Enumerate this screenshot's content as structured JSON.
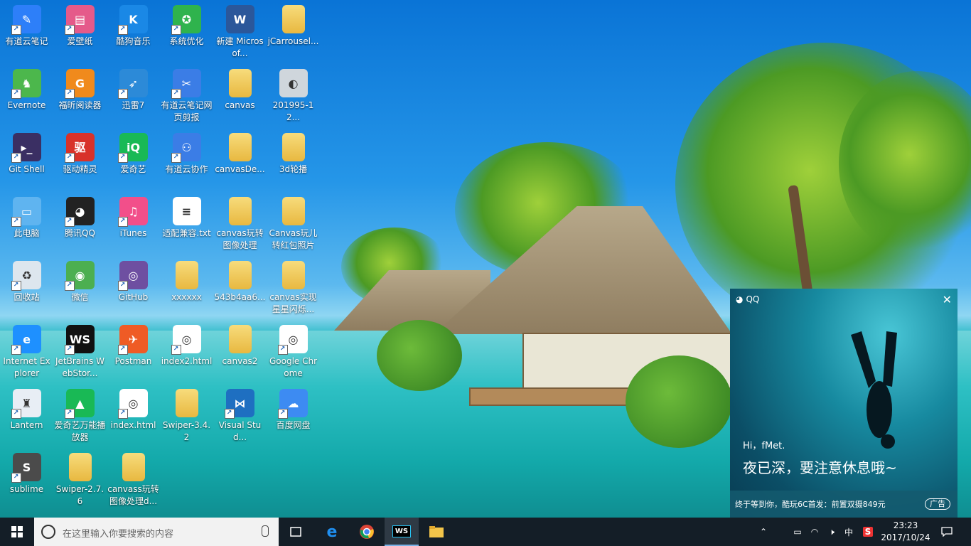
{
  "desktop": {
    "icons": [
      {
        "label": "有道云笔记",
        "icon": "youdao-note-icon",
        "color": "#2d7ff9",
        "glyph": "✎"
      },
      {
        "label": "爱壁纸",
        "icon": "wallpaper-icon",
        "color": "#e55a8a",
        "glyph": "▤"
      },
      {
        "label": "酷狗音乐",
        "icon": "kugou-icon",
        "color": "#1a88e6",
        "glyph": "K"
      },
      {
        "label": "系统优化",
        "icon": "system-optimize-icon",
        "color": "#2fb34d",
        "glyph": "✪"
      },
      {
        "label": "新建 Microsof...",
        "icon": "word-doc-icon",
        "color": "#2b579a",
        "glyph": "W"
      },
      {
        "label": "jCarrousel...",
        "icon": "folder-icon",
        "color": "#f0c850",
        "glyph": ""
      },
      {
        "label": "Evernote",
        "icon": "evernote-icon",
        "color": "#4cb74c",
        "glyph": "♞"
      },
      {
        "label": "福昕阅读器",
        "icon": "foxit-reader-icon",
        "color": "#f08a1c",
        "glyph": "G"
      },
      {
        "label": "迅雷7",
        "icon": "xunlei-icon",
        "color": "#2c8ad8",
        "glyph": "➶"
      },
      {
        "label": "有道云笔记网页剪报",
        "icon": "web-clipper-icon",
        "color": "#3b7de6",
        "glyph": "✂"
      },
      {
        "label": "canvas",
        "icon": "folder-icon",
        "color": "#f0c850",
        "glyph": ""
      },
      {
        "label": "201995-12...",
        "icon": "image-file-icon",
        "color": "#cfd6dc",
        "glyph": "◐"
      },
      {
        "label": "Git Shell",
        "icon": "git-shell-icon",
        "color": "#3a2f63",
        "glyph": "▸_"
      },
      {
        "label": "驱动精灵",
        "icon": "driver-genius-icon",
        "color": "#d8322a",
        "glyph": "驱"
      },
      {
        "label": "爱奇艺",
        "icon": "iqiyi-icon",
        "color": "#19b955",
        "glyph": "iQ"
      },
      {
        "label": "有道云协作",
        "icon": "youdao-collab-icon",
        "color": "#3b7de6",
        "glyph": "⚇"
      },
      {
        "label": "canvasDe...",
        "icon": "folder-icon",
        "color": "#f0c850",
        "glyph": ""
      },
      {
        "label": "3d轮播",
        "icon": "folder-icon",
        "color": "#f0c850",
        "glyph": ""
      },
      {
        "label": "此电脑",
        "icon": "this-pc-icon",
        "color": "#5fb4f0",
        "glyph": "▭"
      },
      {
        "label": "腾讯QQ",
        "icon": "qq-penguin-icon",
        "color": "#222222",
        "glyph": "◕"
      },
      {
        "label": "iTunes",
        "icon": "itunes-icon",
        "color": "#f24f8a",
        "glyph": "♫"
      },
      {
        "label": "适配兼容.txt",
        "icon": "text-file-icon",
        "color": "#ffffff",
        "glyph": "≡"
      },
      {
        "label": "canvas玩转图像处理",
        "icon": "folder-icon",
        "color": "#f0c850",
        "glyph": ""
      },
      {
        "label": "Canvas玩儿转红包照片",
        "icon": "folder-icon",
        "color": "#f0c850",
        "glyph": ""
      },
      {
        "label": "回收站",
        "icon": "recycle-bin-icon",
        "color": "#dde6ee",
        "glyph": "♻"
      },
      {
        "label": "微信",
        "icon": "wechat-icon",
        "color": "#4caf50",
        "glyph": "◉"
      },
      {
        "label": "GitHub",
        "icon": "github-icon",
        "color": "#6e4fa1",
        "glyph": "◎"
      },
      {
        "label": "xxxxxx",
        "icon": "folder-icon",
        "color": "#f0c850",
        "glyph": ""
      },
      {
        "label": "543b4aa6...",
        "icon": "folder-icon",
        "color": "#f0c850",
        "glyph": ""
      },
      {
        "label": "canvas实现星星闪烁...",
        "icon": "folder-icon",
        "color": "#f0c850",
        "glyph": ""
      },
      {
        "label": "Internet Explorer",
        "icon": "ie-icon",
        "color": "#1e90ff",
        "glyph": "e"
      },
      {
        "label": "JetBrains WebStor...",
        "icon": "webstorm-icon",
        "color": "#111111",
        "glyph": "WS"
      },
      {
        "label": "Postman",
        "icon": "postman-icon",
        "color": "#ef5b25",
        "glyph": "✈"
      },
      {
        "label": "index2.html",
        "icon": "chrome-html-icon",
        "color": "#ffffff",
        "glyph": "◎"
      },
      {
        "label": "canvas2",
        "icon": "folder-icon",
        "color": "#f0c850",
        "glyph": ""
      },
      {
        "label": "Google Chrome",
        "icon": "chrome-icon",
        "color": "#ffffff",
        "glyph": "◎"
      },
      {
        "label": "Lantern",
        "icon": "lantern-icon",
        "color": "#e8eef5",
        "glyph": "♜"
      },
      {
        "label": "爱奇艺万能播放器",
        "icon": "iqiyi-player-icon",
        "color": "#19b955",
        "glyph": "▲"
      },
      {
        "label": "index.html",
        "icon": "chrome-html-icon",
        "color": "#ffffff",
        "glyph": "◎"
      },
      {
        "label": "Swiper-3.4.2",
        "icon": "folder-icon",
        "color": "#f0c850",
        "glyph": ""
      },
      {
        "label": "Visual Stud...",
        "icon": "vscode-icon",
        "color": "#1e6fc1",
        "glyph": "⋈"
      },
      {
        "label": "百度网盘",
        "icon": "baidu-netdisk-icon",
        "color": "#3d8bf2",
        "glyph": "☁"
      },
      {
        "label": "sublime",
        "icon": "sublime-icon",
        "color": "#4b4b4b",
        "glyph": "S"
      },
      {
        "label": "Swiper-2.7.6",
        "icon": "folder-icon",
        "color": "#f0c850",
        "glyph": ""
      },
      {
        "label": "canvass玩转图像处理d...",
        "icon": "folder-icon",
        "color": "#f0c850",
        "glyph": ""
      }
    ]
  },
  "qq_popup": {
    "app_label": "QQ",
    "close": "✕",
    "greeting": "Hi，fMet.",
    "message": "夜已深，要注意休息哦~",
    "ad_text": "终于等到你，酷玩6C首发：前置双摄849元",
    "ad_tag": "广告"
  },
  "taskbar": {
    "search_placeholder": "在这里输入你要搜索的内容",
    "pinned": [
      {
        "name": "task-view-button",
        "icon": "task-view-icon"
      },
      {
        "name": "edge-button",
        "icon": "edge-icon"
      },
      {
        "name": "chrome-button",
        "icon": "chrome-icon"
      },
      {
        "name": "webstorm-button",
        "icon": "webstorm-icon",
        "active": true
      },
      {
        "name": "file-explorer-button",
        "icon": "folder-icon"
      }
    ],
    "ime": "中",
    "clock_time": "23:23",
    "clock_date": "2017/10/24"
  }
}
